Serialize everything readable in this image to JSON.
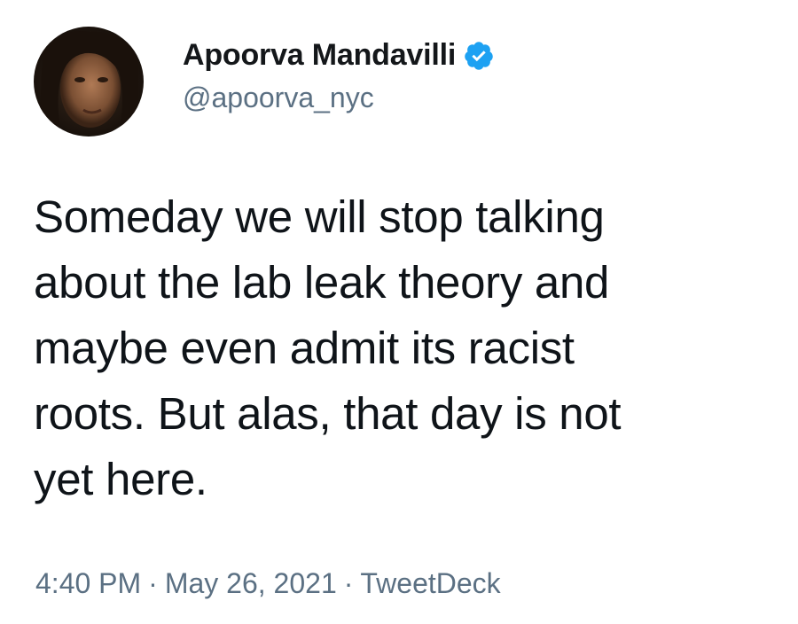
{
  "tweet": {
    "author": {
      "display_name": "Apoorva Mandavilli",
      "handle": "@apoorva_nyc",
      "verified": true,
      "verified_color": "#1da1f2"
    },
    "text_lines": [
      "Someday we will stop talking",
      "about the lab leak theory and",
      "maybe even admit its racist",
      "roots. But alas, that day is not",
      "yet here."
    ],
    "time": "4:40 PM",
    "date": "May 26, 2021",
    "source": "TweetDeck",
    "separator": "·"
  },
  "icons": {
    "avatar": "profile-photo",
    "verified": "verified-badge-icon"
  }
}
